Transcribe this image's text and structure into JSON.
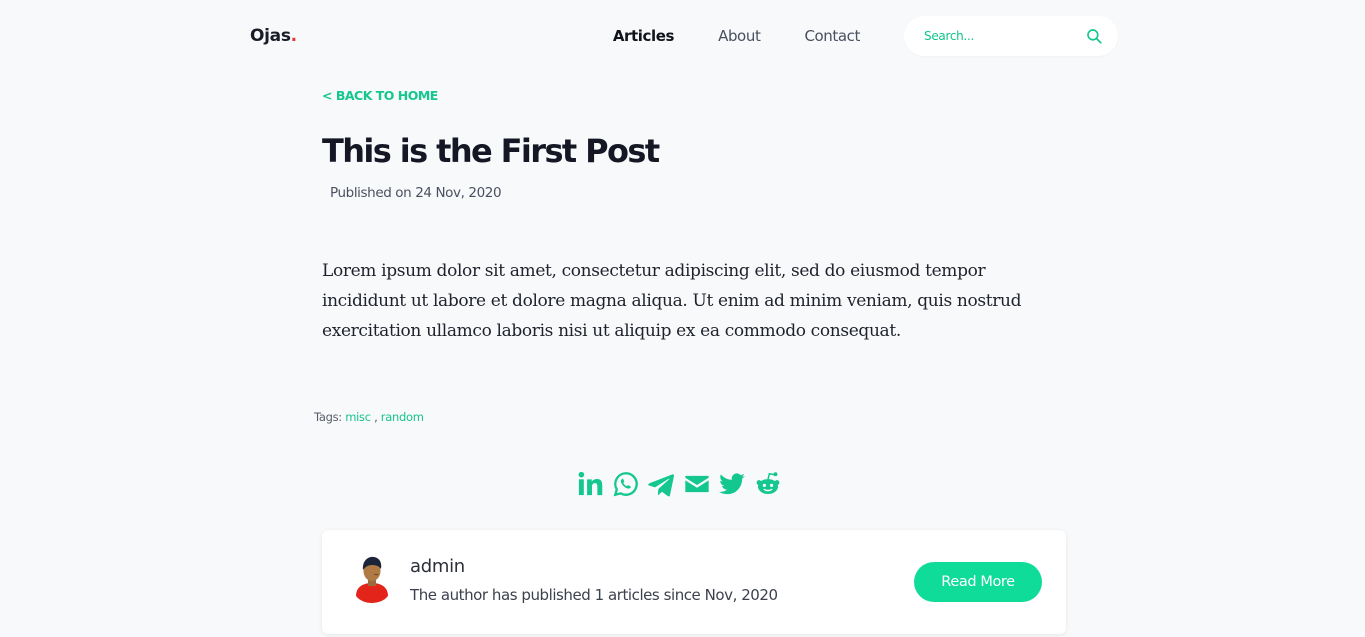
{
  "header": {
    "brand": "Ojas",
    "brand_dot": ".",
    "nav": [
      {
        "label": "Articles",
        "active": true
      },
      {
        "label": "About",
        "active": false
      },
      {
        "label": "Contact",
        "active": false
      }
    ],
    "search_placeholder": "Search..."
  },
  "article": {
    "back_label": "< BACK TO HOME",
    "title": "This is the First Post",
    "published": "Published on 24 Nov, 2020",
    "body": "Lorem ipsum dolor sit amet, consectetur adipiscing elit, sed do eiusmod tempor incididunt ut labore et dolore magna aliqua. Ut enim ad minim veniam, quis nostrud exercitation ullamco laboris nisi ut aliquip ex ea commodo consequat.",
    "tags_label": "Tags:",
    "tags": [
      "misc",
      "random"
    ],
    "tag_separator": " , "
  },
  "share": {
    "icons": [
      "linkedin-icon",
      "whatsapp-icon",
      "telegram-icon",
      "email-icon",
      "twitter-icon",
      "reddit-icon"
    ],
    "color": "#14c78e"
  },
  "author": {
    "name": "admin",
    "info": "The author has published 1 articles since Nov, 2020",
    "button_label": "Read More"
  },
  "colors": {
    "accent": "#10d49a",
    "background": "#f8f9fb",
    "brand_dot": "#e53935"
  }
}
